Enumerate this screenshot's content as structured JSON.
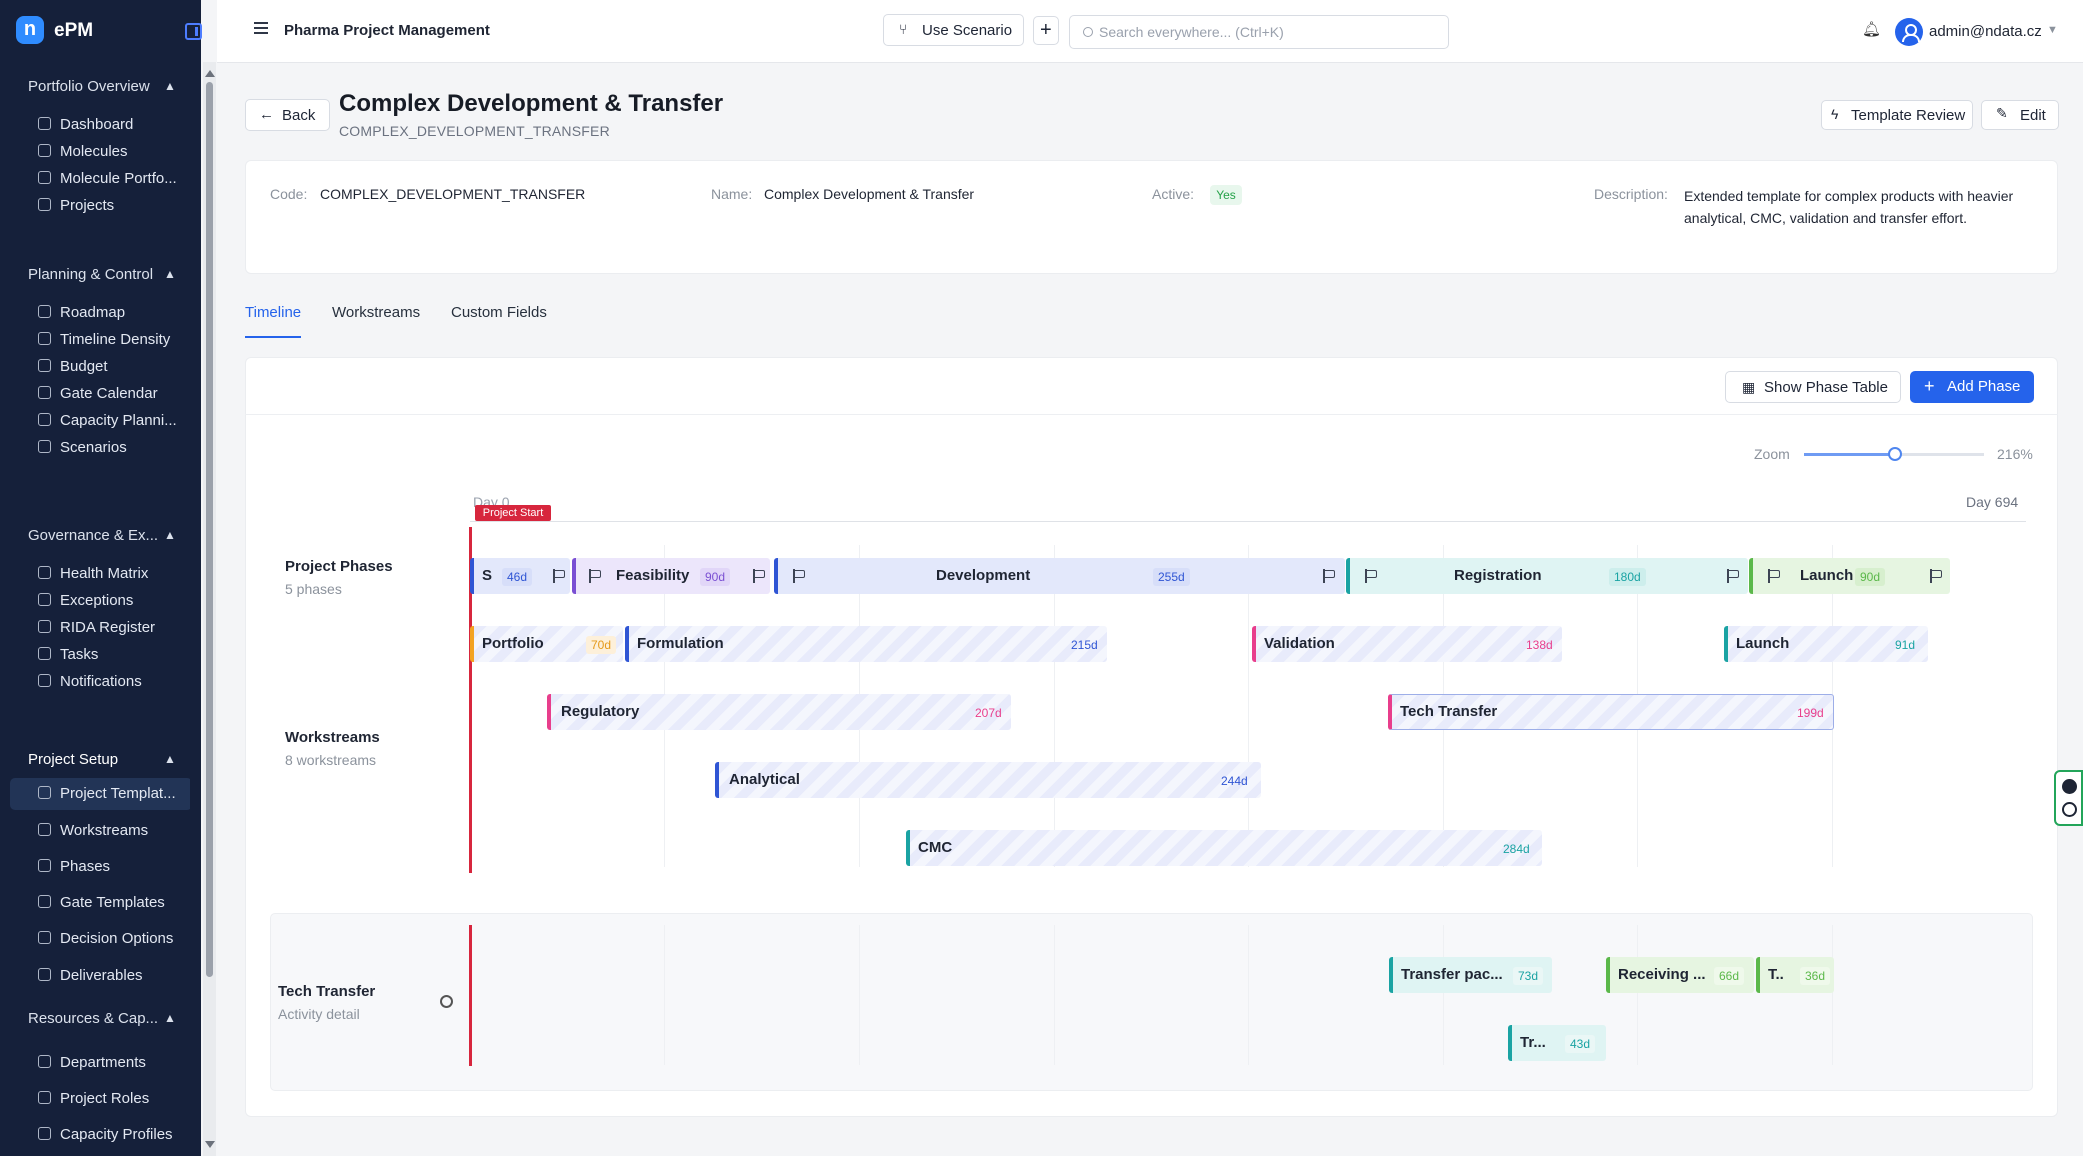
{
  "app": {
    "brand": "ePM",
    "logo_letter": "n",
    "title": "Pharma Project Management"
  },
  "topbar": {
    "scenario_button": "Use Scenario",
    "search_placeholder": "Search everywhere... (Ctrl+K)",
    "user": "admin@ndata.cz"
  },
  "sidebar": {
    "sections": [
      {
        "label": "Portfolio Overview",
        "items": [
          "Dashboard",
          "Molecules",
          "Molecule Portfo...",
          "Projects"
        ]
      },
      {
        "label": "Planning & Control",
        "items": [
          "Roadmap",
          "Timeline Density",
          "Budget",
          "Gate Calendar",
          "Capacity Planni...",
          "Scenarios"
        ]
      },
      {
        "label": "Governance & Ex...",
        "items": [
          "Health Matrix",
          "Exceptions",
          "RIDA Register",
          "Tasks",
          "Notifications"
        ]
      },
      {
        "label": "Project Setup",
        "items": [
          "Project Templat...",
          "Workstreams",
          "Phases",
          "Gate Templates",
          "Decision Options",
          "Deliverables"
        ]
      },
      {
        "label": "Resources & Cap...",
        "items": [
          "Departments",
          "Project Roles",
          "Capacity Profiles"
        ]
      }
    ],
    "active_item": "Project Templat..."
  },
  "page": {
    "back": "Back",
    "title": "Complex Development & Transfer",
    "code_line": "COMPLEX_DEVELOPMENT_TRANSFER",
    "template_review": "Template Review",
    "edit": "Edit"
  },
  "info": {
    "code_label": "Code:",
    "code_value": "COMPLEX_DEVELOPMENT_TRANSFER",
    "name_label": "Name:",
    "name_value": "Complex Development & Transfer",
    "active_label": "Active:",
    "active_value": "Yes",
    "description_label": "Description:",
    "description_value": "Extended template for complex products with heavier analytical, CMC, validation and transfer effort."
  },
  "tabs": [
    "Timeline",
    "Workstreams",
    "Custom Fields"
  ],
  "toolbar": {
    "phase_table": "Show Phase Table",
    "add_phase": "Add Phase"
  },
  "zoom": {
    "label": "Zoom",
    "value": "216%",
    "fraction": 0.5
  },
  "timeline": {
    "day_start": "Day 0",
    "day_end": "Day 694",
    "start_marker": "Project Start",
    "rows": {
      "phases": {
        "title": "Project Phases",
        "subtitle": "5 phases"
      },
      "workstreams": {
        "title": "Workstreams",
        "subtitle": "8 workstreams"
      },
      "detail": {
        "title": "Tech Transfer",
        "subtitle": "Activity detail"
      }
    },
    "phases": [
      {
        "label": "S",
        "duration": "46d"
      },
      {
        "label": "Feasibility",
        "duration": "90d"
      },
      {
        "label": "Development",
        "duration": "255d"
      },
      {
        "label": "Registration",
        "duration": "180d"
      },
      {
        "label": "Launch",
        "duration": "90d"
      }
    ],
    "workstreams": [
      {
        "label": "Portfolio",
        "duration": "70d"
      },
      {
        "label": "Formulation",
        "duration": "215d"
      },
      {
        "label": "Validation",
        "duration": "138d"
      },
      {
        "label": "Launch",
        "duration": "91d"
      },
      {
        "label": "Regulatory",
        "duration": "207d"
      },
      {
        "label": "Tech Transfer",
        "duration": "199d"
      },
      {
        "label": "Analytical",
        "duration": "244d"
      },
      {
        "label": "CMC",
        "duration": "284d"
      }
    ],
    "activities": [
      {
        "label": "Transfer pac...",
        "duration": "73d"
      },
      {
        "label": "Receiving ...",
        "duration": "66d"
      },
      {
        "label": "T..",
        "duration": "36d"
      },
      {
        "label": "Tr...",
        "duration": "43d"
      }
    ]
  },
  "colors": {
    "sidebar_bg": "#15203a",
    "accent": "#2563eb",
    "project_start": "#d7263d",
    "phase_blue": "#2f55d4",
    "phase_purple": "#7a4fd3",
    "phase_teal": "#1aa3a3",
    "phase_green": "#5bb84a",
    "validation_pink": "#e83e8c",
    "portfolio_orange": "#f3a321"
  }
}
